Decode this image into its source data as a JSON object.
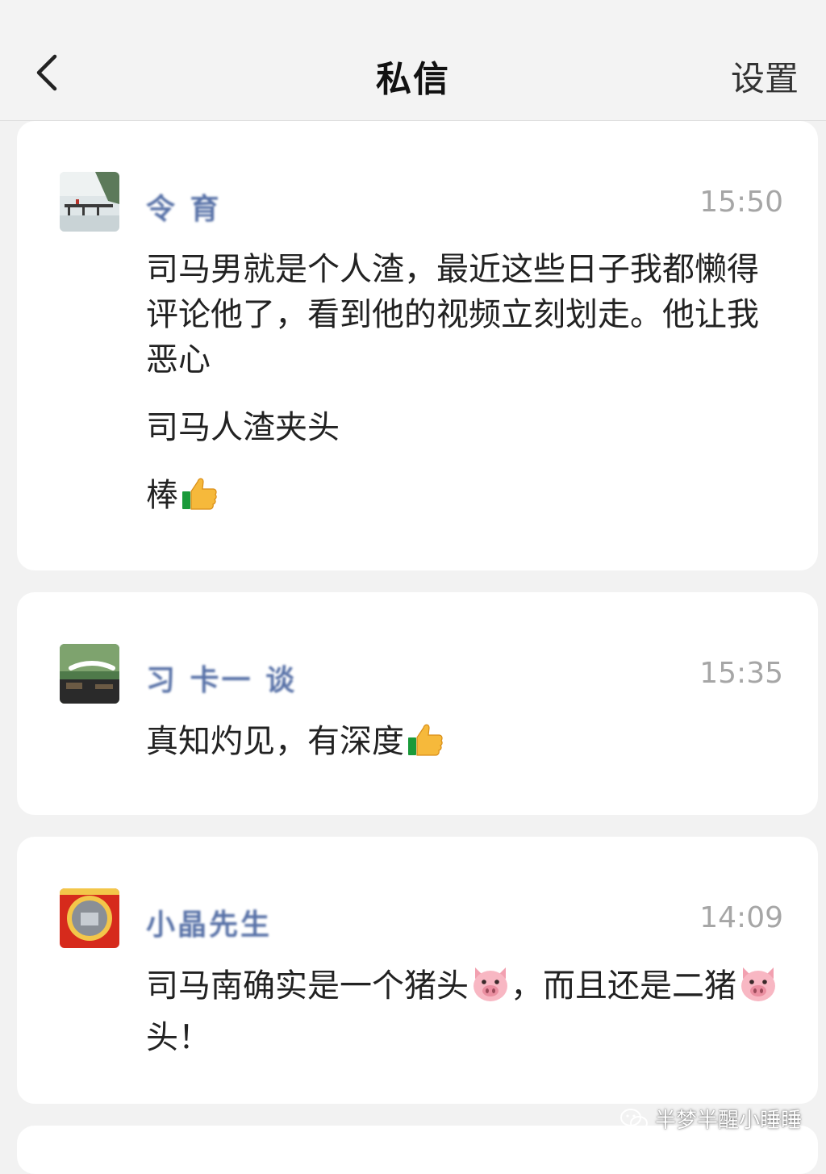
{
  "header": {
    "title": "私信",
    "settings_label": "设置"
  },
  "conversations": [
    {
      "name": "令 育",
      "time": "15:50",
      "messages": [
        "司马男就是个人渣，最近这些日子我都懒得评论他了，看到他的视频立刻划走。他让我恶心",
        "司马人渣夹头",
        "棒"
      ]
    },
    {
      "name": "习 卡一 谈",
      "time": "15:35",
      "messages": [
        "真知灼见，有深度"
      ]
    },
    {
      "name": "小晶先生",
      "time": "14:09",
      "messages": [
        "司马南确实是一个猪头",
        "，而且还是二猪",
        "头！"
      ]
    }
  ],
  "watermark": "半梦半醒小睡睡",
  "icons": {
    "back": "chevron-left-icon",
    "thumbs_up": "thumbs-up-emoji",
    "pig": "pig-face-emoji",
    "watermark": "wechat-icon"
  }
}
